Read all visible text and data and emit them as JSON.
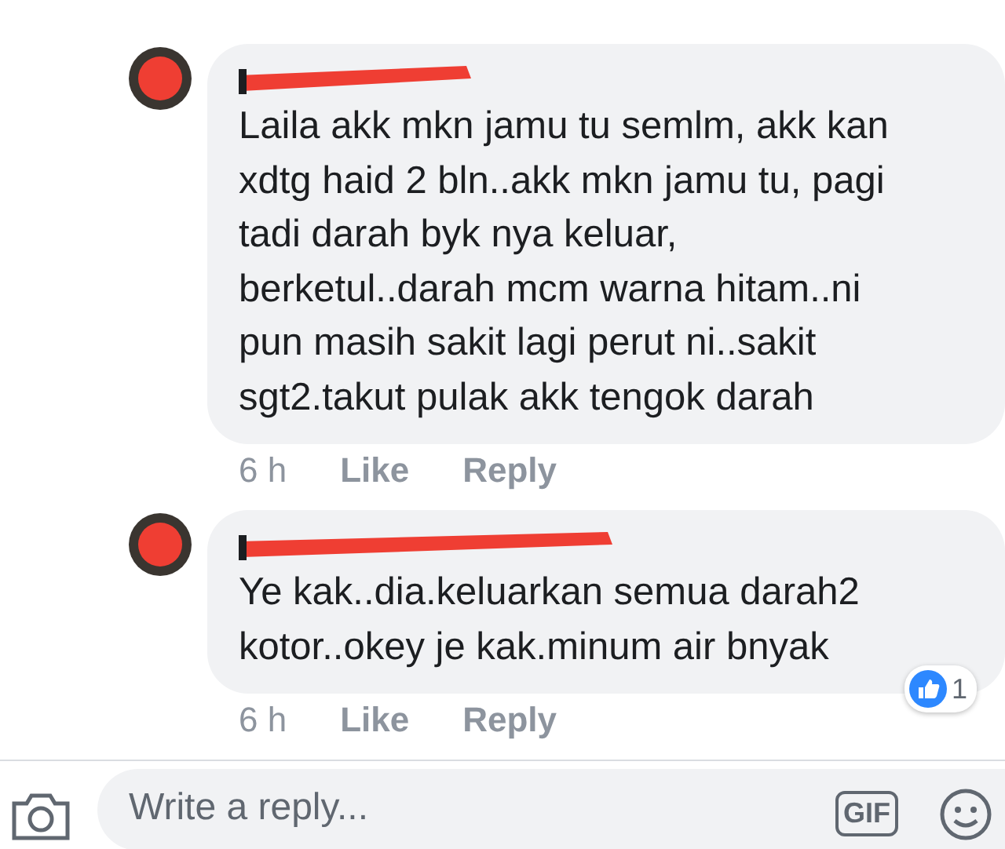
{
  "comments": [
    {
      "author_redacted": true,
      "text": "Laila akk mkn jamu tu semlm, akk kan\nxdtg haid 2 bln..akk mkn jamu tu, pagi\ntadi darah byk nya keluar,\nberketul..darah mcm warna hitam..ni\npun masih sakit lagi perut ni..sakit\nsgt2.takut pulak akk tengok darah",
      "time": "6 h",
      "like": "Like",
      "reply": "Reply"
    },
    {
      "author_redacted": true,
      "text": "Ye kak..dia.keluarkan semua darah2\nkotor..okey je kak.minum air bnyak",
      "time": "6 h",
      "like": "Like",
      "reply": "Reply",
      "reaction_count": "1"
    }
  ],
  "composer": {
    "placeholder": "Write a reply...",
    "gif": "GIF"
  }
}
